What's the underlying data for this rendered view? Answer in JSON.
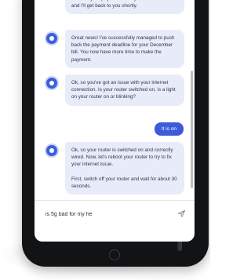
{
  "chat": {
    "messages": [
      {
        "sender": "bot",
        "text": "back for your payment. Kindly hold on for a bit and I'll get back to you shortly."
      },
      {
        "sender": "bot",
        "text": "Great news! I've successfully managed to push back the payment deadline for your December bill. You now have more time to make the payment."
      },
      {
        "sender": "bot",
        "text": "Ok, so you've got an issue with your internet connection. Is your router switched on, is a light on your router on or blinking?"
      },
      {
        "sender": "user",
        "text": "It is on"
      },
      {
        "sender": "bot",
        "text": "Ok, so your router is switched on and correctly wired. Now, let's reboot your router to try to fix your internet issue.",
        "text2": "First, switch off your router and wait for about 30 seconds."
      }
    ]
  },
  "composer": {
    "value": "is 5g bad for my he",
    "send_icon": "send-icon"
  },
  "colors": {
    "accent": "#3d5bd8",
    "bot_bubble": "#e8ecf8",
    "bot_text": "#2f3550",
    "phone_body": "#111315"
  }
}
